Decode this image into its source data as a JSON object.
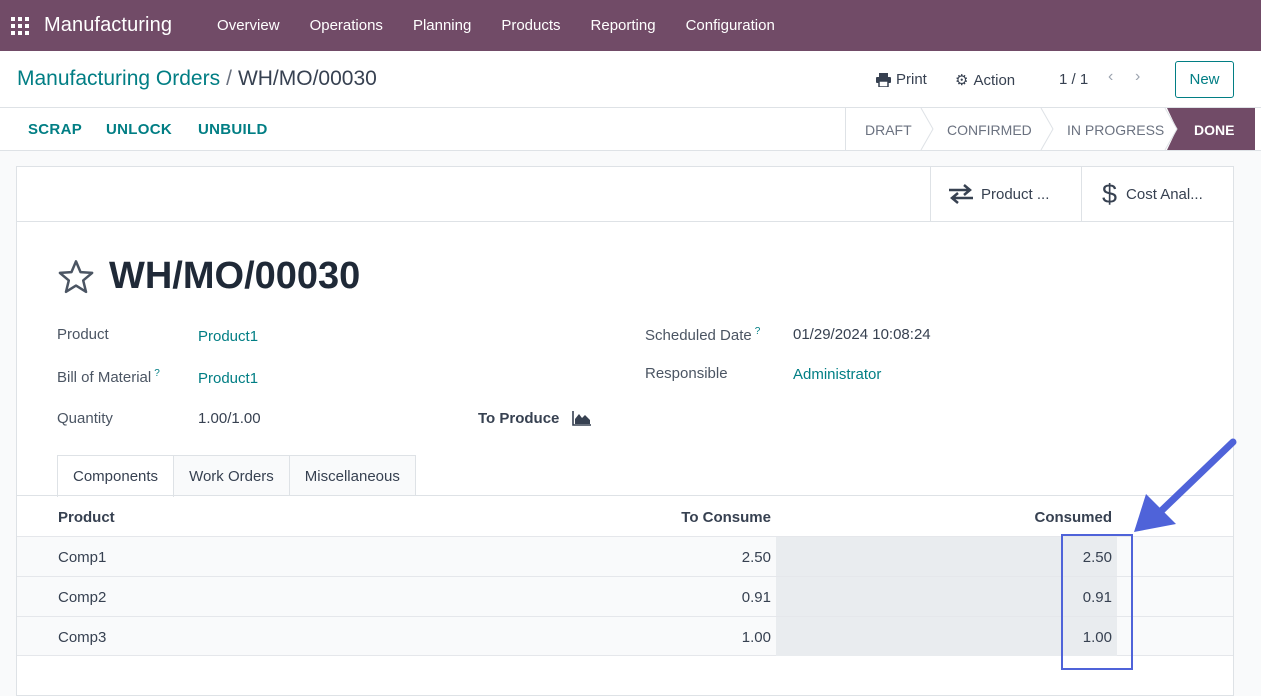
{
  "topnav": {
    "app_name": "Manufacturing",
    "menu": [
      "Overview",
      "Operations",
      "Planning",
      "Products",
      "Reporting",
      "Configuration"
    ]
  },
  "control_panel": {
    "breadcrumb_parent": "Manufacturing Orders",
    "breadcrumb_separator": "/",
    "breadcrumb_current": "WH/MO/00030",
    "print_label": "Print",
    "action_label": "Action",
    "pager": "1 / 1",
    "new_label": "New"
  },
  "statusbar": {
    "buttons": [
      "SCRAP",
      "UNLOCK",
      "UNBUILD"
    ],
    "stages": [
      "DRAFT",
      "CONFIRMED",
      "IN PROGRESS",
      "DONE"
    ],
    "active_stage": "DONE"
  },
  "smart_buttons": {
    "product_moves": "Product ...",
    "cost_analysis": "Cost Anal..."
  },
  "record": {
    "title": "WH/MO/00030",
    "product_label": "Product",
    "product_value": "Product1",
    "bom_label": "Bill of Material",
    "bom_value": "Product1",
    "quantity_label": "Quantity",
    "quantity_value": "1.00/1.00",
    "to_produce_label": "To Produce",
    "scheduled_date_label": "Scheduled Date",
    "scheduled_date_value": "01/29/2024 10:08:24",
    "responsible_label": "Responsible",
    "responsible_value": "Administrator",
    "help_mark": "?"
  },
  "tabs": [
    "Components",
    "Work Orders",
    "Miscellaneous"
  ],
  "components_table": {
    "headers": [
      "Product",
      "To Consume",
      "Consumed"
    ],
    "rows": [
      {
        "product": "Comp1",
        "to_consume": "2.50",
        "consumed": "2.50"
      },
      {
        "product": "Comp2",
        "to_consume": "0.91",
        "consumed": "0.91"
      },
      {
        "product": "Comp3",
        "to_consume": "1.00",
        "consumed": "1.00"
      }
    ]
  },
  "colors": {
    "brand": "#714b67",
    "link": "#017e84",
    "annotation": "#4f63d9"
  }
}
